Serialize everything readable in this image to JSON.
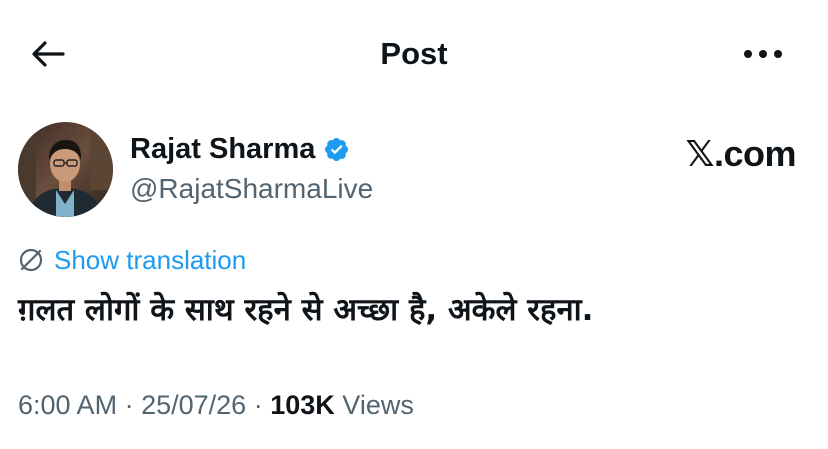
{
  "header": {
    "title": "Post",
    "back_icon": "arrow-left-icon",
    "more_icon": "more-horizontal-icon"
  },
  "author": {
    "name": "Rajat Sharma",
    "handle": "@RajatSharmaLive",
    "verified": true,
    "verified_color": "#1d9bf0"
  },
  "brand": {
    "text": "𝕏.com"
  },
  "translation": {
    "label": "Show translation",
    "color": "#1d9bf0"
  },
  "post": {
    "text": "ग़लत लोगों के साथ रहने से अच्छा है, अकेले रहना."
  },
  "meta": {
    "time": "6:00 AM",
    "separator": "·",
    "date": "25/07/26",
    "views_count": "103K",
    "views_label": "Views"
  }
}
